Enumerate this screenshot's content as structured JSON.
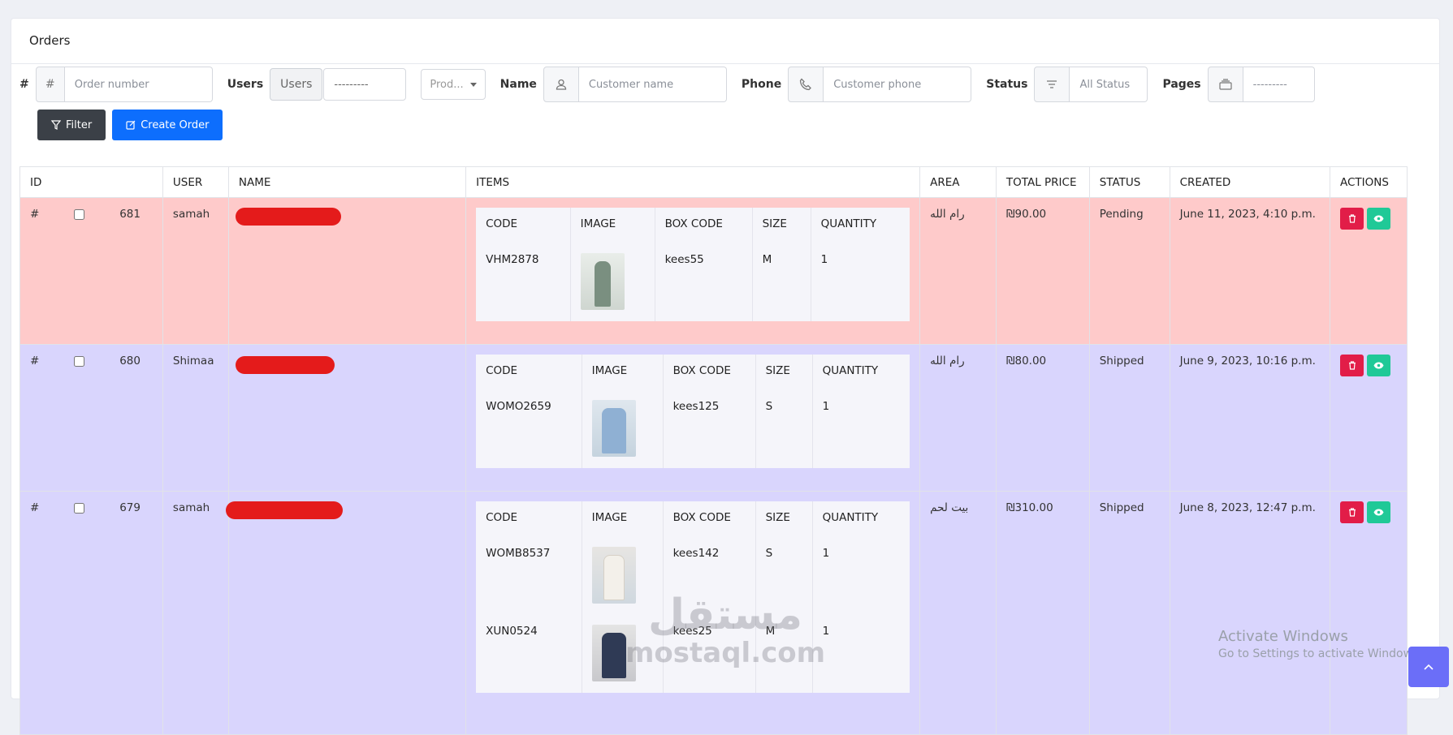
{
  "page": {
    "title": "Orders"
  },
  "filters": {
    "hash_label": "#",
    "order_icon": "#",
    "order_placeholder": "Order number",
    "users_label": "Users",
    "users_button": "Users",
    "users_value": "---------",
    "products_value": "Prod...",
    "name_label": "Name",
    "name_placeholder": "Customer name",
    "phone_label": "Phone",
    "phone_placeholder": "Customer phone",
    "status_label": "Status",
    "status_value": "All Status",
    "pages_label": "Pages",
    "pages_value": "---------"
  },
  "buttons": {
    "filter": "Filter",
    "create": "Create Order"
  },
  "table": {
    "headers": [
      "ID",
      "USER",
      "NAME",
      "ITEMS",
      "AREA",
      "TOTAL PRICE",
      "STATUS",
      "CREATED",
      "ACTIONS"
    ],
    "item_headers": [
      "CODE",
      "IMAGE",
      "BOX CODE",
      "SIZE",
      "QUANTITY"
    ],
    "rows": [
      {
        "hash": "#",
        "id": "681",
        "user": "samah",
        "area": "رام الله",
        "total": "₪90.00",
        "status": "Pending",
        "created": "June 11, 2023, 4:10 p.m.",
        "items": [
          {
            "code": "VHM2878",
            "box": "kees55",
            "size": "M",
            "qty": "1"
          }
        ]
      },
      {
        "hash": "#",
        "id": "680",
        "user": "Shimaa",
        "area": "رام الله",
        "total": "₪80.00",
        "status": "Shipped",
        "created": "June 9, 2023, 10:16 p.m.",
        "items": [
          {
            "code": "WOMO2659",
            "box": "kees125",
            "size": "S",
            "qty": "1"
          }
        ]
      },
      {
        "hash": "#",
        "id": "679",
        "user": "samah",
        "area": "بيت لحم",
        "total": "₪310.00",
        "status": "Shipped",
        "created": "June 8, 2023, 12:47 p.m.",
        "items": [
          {
            "code": "WOMB8537",
            "box": "kees142",
            "size": "S",
            "qty": "1"
          },
          {
            "code": "XUN0524",
            "box": "kees25",
            "size": "M",
            "qty": "1"
          }
        ]
      }
    ]
  },
  "overlay": {
    "activate_title": "Activate Windows",
    "activate_sub": "Go to Settings to activate Windows.",
    "mostaql_ar": "مستقل",
    "mostaql_en": "mostaql.com",
    "scroll_top_icon": "chevron-up-icon"
  }
}
